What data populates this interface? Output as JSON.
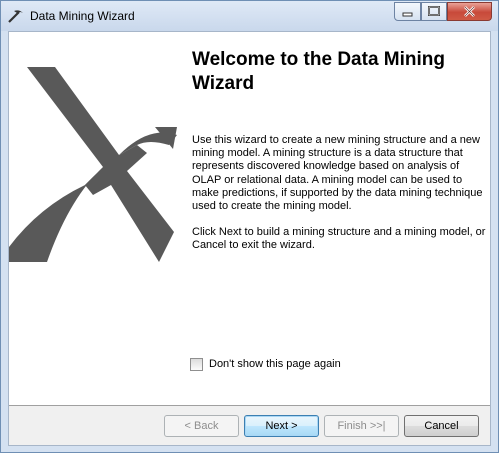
{
  "window": {
    "title": "Data Mining Wizard",
    "icon": "pickaxe-icon"
  },
  "caption_buttons": {
    "minimize_icon": "minimize-icon",
    "maximize_icon": "maximize-icon",
    "close_icon": "close-icon"
  },
  "page": {
    "heading": "Welcome to the Data Mining Wizard",
    "paragraph1": "Use this wizard to create a new mining structure and a new mining model. A mining structure is a data structure that represents discovered knowledge based on analysis of OLAP or relational data.  A mining model can be used to make predictions, if supported by the data mining technique used to create the mining model.",
    "paragraph2": "Click Next to build a mining structure and a mining model, or Cancel to exit the wizard.",
    "graphic": "pickaxe-graphic"
  },
  "checkbox": {
    "label": "Don't show this page again",
    "checked": false
  },
  "buttons": {
    "back": "< Back",
    "next": "Next >",
    "finish": "Finish >>|",
    "cancel": "Cancel"
  },
  "colors": {
    "titlebar": "#d4e1f1",
    "close_button": "#c8493a",
    "graphic": "#595959"
  }
}
